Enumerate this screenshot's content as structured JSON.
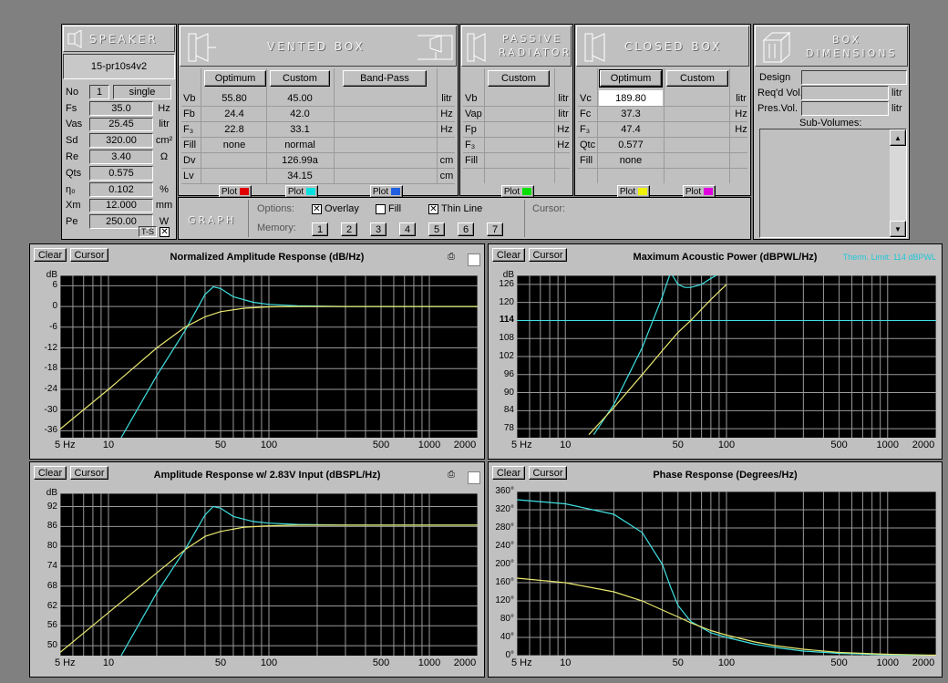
{
  "speaker": {
    "header": "SPEAKER",
    "model": "15-pr10s4v2",
    "rows": [
      {
        "name": "No",
        "value": "1",
        "extra": "single",
        "unit": ""
      },
      {
        "name": "Fs",
        "value": "35.0",
        "unit": "Hz"
      },
      {
        "name": "Vas",
        "value": "25.45",
        "unit": "litr"
      },
      {
        "name": "Sd",
        "value": "320.00",
        "unit": "cm²"
      },
      {
        "name": "Re",
        "value": "3.40",
        "unit": "Ω"
      },
      {
        "name": "Qts",
        "value": "0.575",
        "unit": ""
      },
      {
        "name": "η₀",
        "value": "0.102",
        "unit": "%"
      },
      {
        "name": "Xm",
        "value": "12.000",
        "unit": "mm"
      },
      {
        "name": "Pe",
        "value": "250.00",
        "unit": "W"
      }
    ],
    "ts_label": "T-S",
    "ts_check": "✕"
  },
  "vented": {
    "header": "VENTED BOX",
    "buttons": [
      "Optimum",
      "Custom",
      "Band-Pass"
    ],
    "rows": [
      {
        "name": "Vb",
        "opt": "55.80",
        "cus": "45.00",
        "bp": "",
        "unit": "litr"
      },
      {
        "name": "Fb",
        "opt": "24.4",
        "cus": "42.0",
        "bp": "",
        "unit": "Hz"
      },
      {
        "name": "F₃",
        "opt": "22.8",
        "cus": "33.1",
        "bp": "",
        "unit": "Hz"
      },
      {
        "name": "Fill",
        "opt": "none",
        "cus": "normal",
        "bp": "",
        "unit": ""
      },
      {
        "name": "Dv",
        "opt": "",
        "cus": "126.99a",
        "bp": "",
        "unit": "cm"
      },
      {
        "name": "Lv",
        "opt": "",
        "cus": "34.15",
        "bp": "",
        "unit": "cm"
      }
    ],
    "plot_label": "Plot",
    "plot_colors": [
      "#e00000",
      "#00e0e0",
      "#2060e0"
    ]
  },
  "passive": {
    "header1": "PASSIVE",
    "header2": "RADIATOR",
    "button": "Custom",
    "rows": [
      {
        "name": "Vb",
        "unit": "litr"
      },
      {
        "name": "Vap",
        "unit": "litr"
      },
      {
        "name": "Fp",
        "unit": "Hz"
      },
      {
        "name": "F₃",
        "unit": "Hz"
      },
      {
        "name": "Fill",
        "unit": ""
      }
    ],
    "plot_label": "Plot",
    "plot_color": "#00e000"
  },
  "closed": {
    "header": "CLOSED BOX",
    "buttons": [
      "Optimum",
      "Custom"
    ],
    "rows": [
      {
        "name": "Vc",
        "opt": "189.80",
        "cus": "",
        "unit": "litr"
      },
      {
        "name": "Fc",
        "opt": "37.3",
        "cus": "",
        "unit": "Hz"
      },
      {
        "name": "F₃",
        "opt": "47.4",
        "cus": "",
        "unit": "Hz"
      },
      {
        "name": "Qtc",
        "opt": "0.577",
        "cus": "",
        "unit": ""
      },
      {
        "name": "Fill",
        "opt": "none",
        "cus": "",
        "unit": ""
      }
    ],
    "plot_label": "Plot",
    "plot_colors": [
      "#f0f000",
      "#e000e0"
    ]
  },
  "dimensions": {
    "header1": "BOX",
    "header2": "DIMENSIONS",
    "design_label": "Design",
    "reqd_label": "Req'd Vol.",
    "pres_label": "Pres.Vol.",
    "unit": "litr",
    "subvolumes_label": "Sub-Volumes:"
  },
  "graph": {
    "label": "GRAPH",
    "options_label": "Options:",
    "overlay_label": "Overlay",
    "fill_label": "Fill",
    "thin_label": "Thin Line",
    "memory_label": "Memory:",
    "memory_buttons": [
      "1",
      "2",
      "3",
      "4",
      "5",
      "6",
      "7"
    ],
    "cursor_label": "Cursor:"
  },
  "charts": {
    "clear_label": "Clear",
    "cursor_label": "Cursor",
    "xticks": [
      "5 Hz",
      "10",
      "50",
      "100",
      "500",
      "1000",
      "2000"
    ],
    "items": [
      {
        "title": "Normalized Amplitude Response (dB/Hz)",
        "yticks": [
          "dB",
          "6",
          "0",
          "-6",
          "-12",
          "-18",
          "-24",
          "-30",
          "-36"
        ],
        "note": ""
      },
      {
        "title": "Maximum Acoustic Power (dBPWL/Hz)",
        "yticks": [
          "dB",
          "126",
          "120",
          "114",
          "108",
          "102",
          "96",
          "90",
          "84",
          "78"
        ],
        "note": "Therm. Limit: 114 dBPWL"
      },
      {
        "title": "Amplitude Response w/ 2.83V Input (dBSPL/Hz)",
        "yticks": [
          "dB",
          "92",
          "86",
          "80",
          "74",
          "68",
          "62",
          "56",
          "50"
        ],
        "note": ""
      },
      {
        "title": "Phase Response (Degrees/Hz)",
        "yticks": [
          "360°",
          "320°",
          "280°",
          "240°",
          "200°",
          "160°",
          "120°",
          "80°",
          "40°",
          "0°"
        ],
        "note": ""
      }
    ]
  },
  "chart_data": [
    {
      "type": "line",
      "title": "Normalized Amplitude Response (dB/Hz)",
      "xscale": "log",
      "xlim": [
        5,
        2000
      ],
      "ylim": [
        -38,
        9
      ],
      "series": [
        {
          "color": "#40e0e0",
          "x": [
            12,
            20,
            30,
            40,
            45,
            50,
            60,
            80,
            100,
            150,
            300,
            2000
          ],
          "y": [
            -38,
            -20,
            -7,
            3.5,
            5.7,
            5.2,
            2.8,
            1.2,
            0.6,
            0.2,
            0,
            0
          ]
        },
        {
          "color": "#e8e870",
          "x": [
            5,
            10,
            20,
            30,
            40,
            50,
            70,
            100,
            150,
            300,
            2000
          ],
          "y": [
            -35.5,
            -24,
            -12,
            -6,
            -3,
            -1.5,
            -0.5,
            -0.1,
            0,
            0,
            0
          ]
        }
      ]
    },
    {
      "type": "line",
      "title": "Maximum Acoustic Power (dBPWL/Hz)",
      "xscale": "log",
      "xlim": [
        5,
        2000
      ],
      "ylim": [
        75,
        129
      ],
      "series": [
        {
          "color": "#40e0e0",
          "x": [
            15,
            20,
            30,
            40,
            45,
            50,
            55,
            60,
            70,
            80,
            100
          ],
          "y": [
            76,
            86,
            105,
            122,
            130,
            126,
            125,
            125,
            126,
            128,
            131
          ]
        },
        {
          "color": "#e8e870",
          "x": [
            14,
            20,
            30,
            40,
            50,
            60,
            80,
            100
          ],
          "y": [
            76,
            85,
            96,
            104,
            110,
            114,
            121,
            126
          ]
        }
      ],
      "therm_limit": 114
    },
    {
      "type": "line",
      "title": "Amplitude Response w/ 2.83V Input (dBSPL/Hz)",
      "xscale": "log",
      "xlim": [
        5,
        2000
      ],
      "ylim": [
        47,
        96
      ],
      "series": [
        {
          "color": "#40e0e0",
          "x": [
            12,
            20,
            30,
            40,
            45,
            50,
            60,
            80,
            100,
            150,
            300,
            2000
          ],
          "y": [
            47,
            66,
            79,
            89.5,
            92,
            91.5,
            89,
            87.5,
            87,
            86.6,
            86.4,
            86.4
          ]
        },
        {
          "color": "#e8e870",
          "x": [
            5,
            10,
            20,
            30,
            40,
            50,
            70,
            100,
            150,
            300,
            2000
          ],
          "y": [
            48,
            60,
            72,
            79,
            83,
            84.5,
            85.8,
            86.2,
            86.4,
            86.4,
            86.4
          ]
        }
      ]
    },
    {
      "type": "line",
      "title": "Phase Response (Degrees/Hz)",
      "xscale": "log",
      "xlim": [
        5,
        2000
      ],
      "ylim": [
        0,
        360
      ],
      "series": [
        {
          "color": "#40e0e0",
          "x": [
            5,
            10,
            20,
            30,
            40,
            45,
            50,
            60,
            80,
            100,
            150,
            200,
            300,
            500,
            1000,
            2000
          ],
          "y": [
            342,
            333,
            310,
            270,
            200,
            150,
            110,
            75,
            50,
            40,
            25,
            18,
            10,
            5,
            2,
            0
          ]
        },
        {
          "color": "#e8e870",
          "x": [
            5,
            10,
            20,
            30,
            40,
            50,
            60,
            80,
            100,
            150,
            200,
            300,
            500,
            1000,
            2000
          ],
          "y": [
            170,
            160,
            140,
            120,
            100,
            85,
            72,
            55,
            45,
            30,
            22,
            14,
            7,
            3,
            1
          ]
        }
      ]
    }
  ]
}
